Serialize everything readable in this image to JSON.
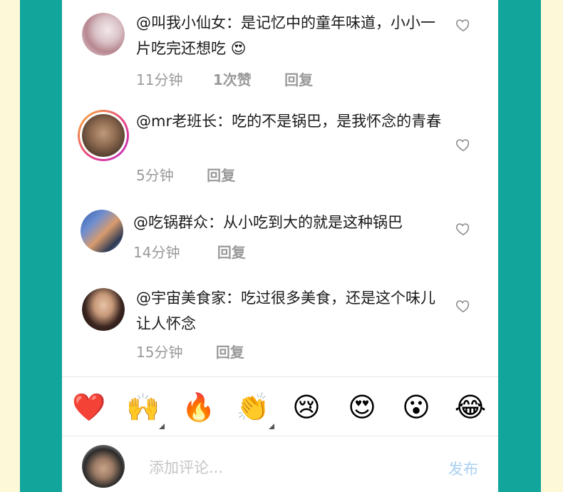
{
  "comments": [
    {
      "text": "@叫我小仙女：是记忆中的童年味道，小小一片吃完还想吃 😍",
      "time": "11分钟",
      "likes": "1次赞",
      "reply": "回复"
    },
    {
      "text": "@mr老班长：吃的不是锅巴，是我怀念的青春",
      "time": "5分钟",
      "likes": "",
      "reply": "回复"
    },
    {
      "text": "@吃锅群众：从小吃到大的就是这种锅巴",
      "time": "14分钟",
      "likes": "",
      "reply": "回复"
    },
    {
      "text": "@宇宙美食家：吃过很多美食，还是这个味儿让人怀念",
      "time": "15分钟",
      "likes": "",
      "reply": "回复"
    }
  ],
  "reactions": [
    "❤️",
    "🙌",
    "🔥",
    "👏",
    "😢",
    "😍",
    "😮",
    "😂"
  ],
  "composer": {
    "placeholder": "添加评论...",
    "post_label": "发布"
  },
  "colors": {
    "frame": "#12a59b",
    "background": "#fdf8d8",
    "post": "#a9cff2",
    "meta": "#9a9a9a"
  }
}
